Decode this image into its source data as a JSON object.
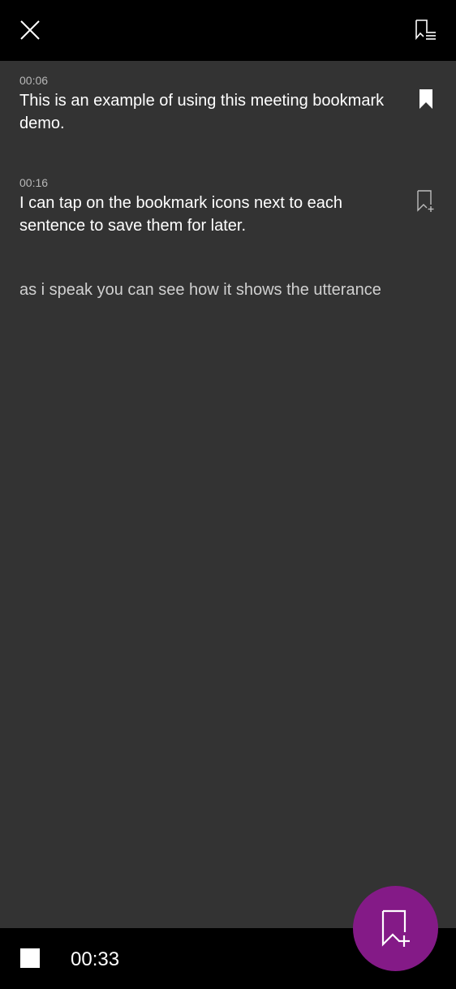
{
  "header": {
    "close_icon": "close-icon",
    "bookmark_list_icon": "bookmark-list-icon"
  },
  "transcript": {
    "entries": [
      {
        "timestamp": "00:06",
        "text": "This is an example of using this meeting bookmark demo.",
        "bookmarked": true,
        "icon": "bookmark-filled-icon"
      },
      {
        "timestamp": "00:16",
        "text": "I can tap on the bookmark icons next to each sentence to save them for later.",
        "bookmarked": false,
        "icon": "bookmark-add-icon"
      }
    ],
    "partial": {
      "text": "as i speak you can see how it shows the utterance"
    }
  },
  "footer": {
    "stop_icon": "stop-icon",
    "elapsed": "00:33"
  },
  "fab": {
    "icon": "bookmark-add-icon",
    "color": "#841a87"
  },
  "colors": {
    "background": "#333333",
    "bars": "#000000",
    "accent": "#841a87"
  }
}
